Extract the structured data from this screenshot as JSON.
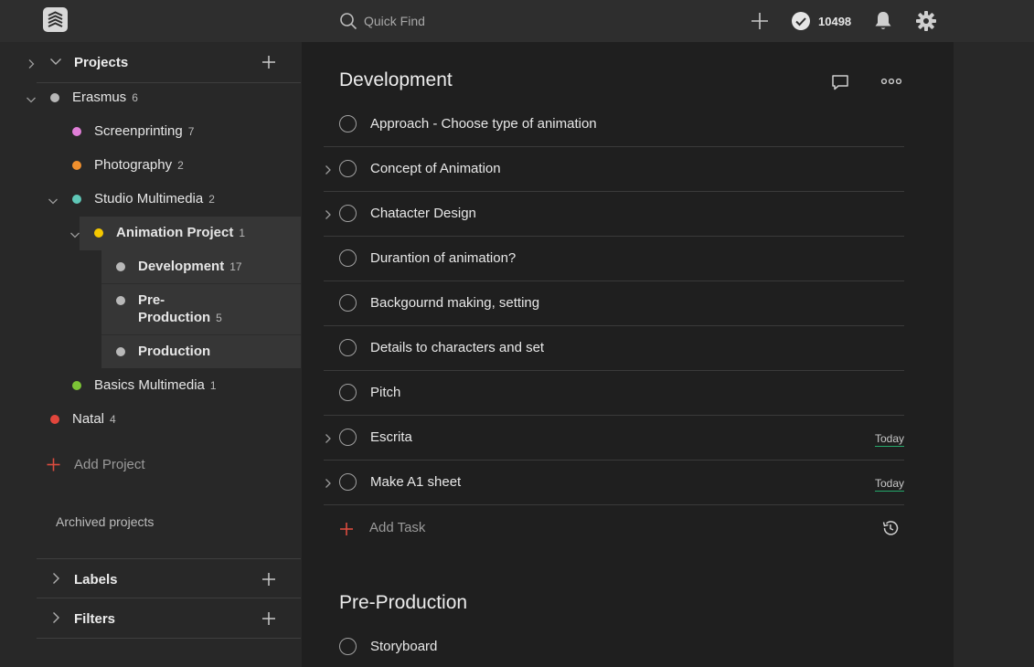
{
  "topbar": {
    "search_placeholder": "Quick Find",
    "karma_count": "10498"
  },
  "sidebar": {
    "projects_title": "Projects",
    "projects": [
      {
        "name": "Erasmus",
        "count": "6",
        "color": "#b8b8b8"
      },
      {
        "name": "Screenprinting",
        "count": "7",
        "color": "#e07ed7"
      },
      {
        "name": "Photography",
        "count": "2",
        "color": "#f0902e"
      },
      {
        "name": "Studio Multimedia",
        "count": "2",
        "color": "#5fc7b7"
      },
      {
        "name": "Animation Project",
        "count": "1",
        "color": "#f5c800"
      },
      {
        "name": "Development",
        "count": "17",
        "color": "#b8b8b8"
      },
      {
        "name": "Pre-Production",
        "name_line1": "Pre-",
        "name_line2": "Production",
        "count": "5",
        "color": "#b8b8b8"
      },
      {
        "name": "Production",
        "count": "",
        "color": "#b8b8b8"
      },
      {
        "name": "Basics Multimedia",
        "count": "1",
        "color": "#7cc436"
      },
      {
        "name": "Natal",
        "count": "4",
        "color": "#e2463c"
      }
    ],
    "add_project_label": "Add Project",
    "archived_label": "Archived projects",
    "labels_title": "Labels",
    "filters_title": "Filters"
  },
  "main": {
    "sections": [
      {
        "title": "Development",
        "tasks": [
          {
            "text": "Approach - Choose type of animation",
            "has_subtasks": false,
            "due": ""
          },
          {
            "text": "Concept of Animation",
            "has_subtasks": true,
            "due": ""
          },
          {
            "text": "Chatacter Design",
            "has_subtasks": true,
            "due": ""
          },
          {
            "text": "Durantion of animation?",
            "has_subtasks": false,
            "due": ""
          },
          {
            "text": "Backgournd making, setting",
            "has_subtasks": false,
            "due": ""
          },
          {
            "text": "Details to characters and set",
            "has_subtasks": false,
            "due": ""
          },
          {
            "text": "Pitch",
            "has_subtasks": false,
            "due": ""
          },
          {
            "text": "Escrita",
            "has_subtasks": true,
            "due": "Today"
          },
          {
            "text": "Make A1 sheet",
            "has_subtasks": true,
            "due": "Today"
          }
        ],
        "add_task_label": "Add Task"
      },
      {
        "title": "Pre-Production",
        "tasks": [
          {
            "text": "Storyboard",
            "has_subtasks": false,
            "due": ""
          }
        ]
      }
    ]
  },
  "colors": {
    "accent_red": "#db4c3f",
    "due_today_underline": "#25a86b"
  }
}
